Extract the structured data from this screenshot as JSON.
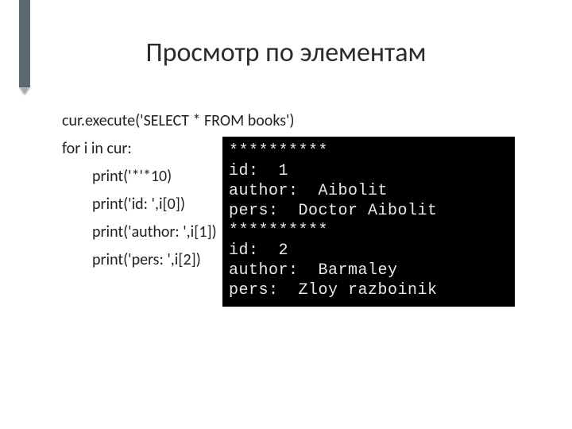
{
  "title": "Просмотр по элементам",
  "code": {
    "l1": "cur.execute('SELECT * FROM books')",
    "l2": "for i in cur:",
    "l3": "print('*'*10)",
    "l4": "print('id: ',i[0])",
    "l5": "print('author: ',i[1])",
    "l6": "print('pers: ',i[2])"
  },
  "terminal": {
    "t1": "**********",
    "t2": "id:  1",
    "t3": "author:  Aibolit",
    "t4": "pers:  Doctor Aibolit",
    "t5": "**********",
    "t6": "id:  2",
    "t7": "author:  Barmaley",
    "t8": "pers:  Zloy razboinik"
  }
}
